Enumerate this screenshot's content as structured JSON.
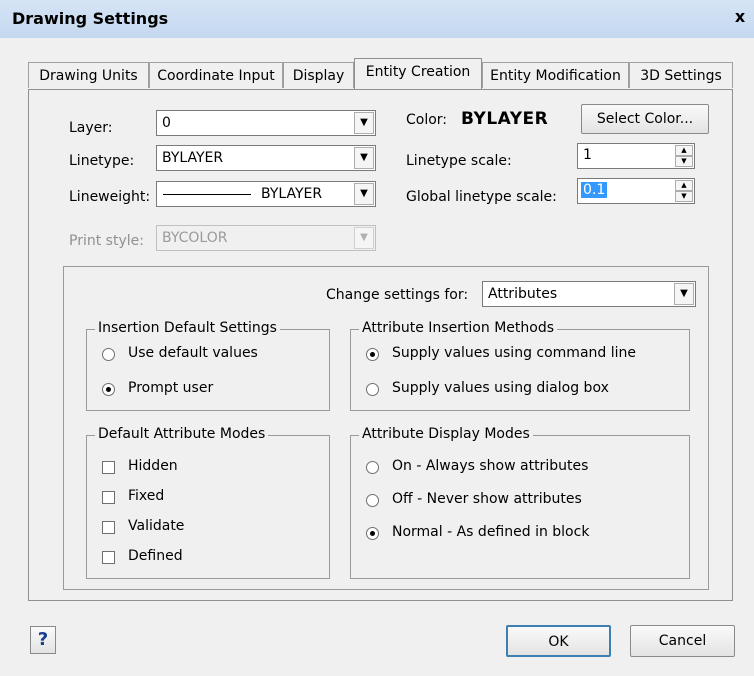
{
  "window": {
    "title": "Drawing Settings",
    "close_glyph": "x"
  },
  "tabs": [
    {
      "label": "Drawing Units"
    },
    {
      "label": "Coordinate Input"
    },
    {
      "label": "Display"
    },
    {
      "label": "Entity Creation"
    },
    {
      "label": "Entity Modification"
    },
    {
      "label": "3D Settings"
    }
  ],
  "active_tab": "Entity Creation",
  "entity": {
    "layer_label": "Layer:",
    "layer_value": "0",
    "linetype_label": "Linetype:",
    "linetype_value": "BYLAYER",
    "lineweight_label": "Lineweight:",
    "lineweight_value": "BYLAYER",
    "print_style_label": "Print style:",
    "print_style_value": "BYCOLOR",
    "color_label": "Color:",
    "color_value": "BYLAYER",
    "select_color_button": "Select Color...",
    "linetype_scale_label": "Linetype scale:",
    "linetype_scale_value": "1",
    "global_linetype_scale_label": "Global linetype scale:",
    "global_linetype_scale_value": "0.1"
  },
  "settings_for": {
    "label": "Change settings for:",
    "value": "Attributes"
  },
  "insertion_defaults": {
    "title": "Insertion Default Settings",
    "options": [
      {
        "label": "Use default values",
        "selected": false
      },
      {
        "label": "Prompt user",
        "selected": true
      }
    ]
  },
  "insertion_methods": {
    "title": "Attribute Insertion Methods",
    "options": [
      {
        "label": "Supply values using command line",
        "selected": true
      },
      {
        "label": "Supply values using dialog box",
        "selected": false
      }
    ]
  },
  "attribute_modes": {
    "title": "Default Attribute Modes",
    "options": [
      {
        "label": "Hidden",
        "checked": false
      },
      {
        "label": "Fixed",
        "checked": false
      },
      {
        "label": "Validate",
        "checked": false
      },
      {
        "label": "Defined",
        "checked": false
      }
    ]
  },
  "display_modes": {
    "title": "Attribute Display Modes",
    "options": [
      {
        "label": "On - Always show attributes",
        "selected": false
      },
      {
        "label": "Off - Never show attributes",
        "selected": false
      },
      {
        "label": "Normal - As defined in block",
        "selected": true
      }
    ]
  },
  "footer": {
    "help_glyph": "?",
    "ok_label": "OK",
    "cancel_label": "Cancel"
  },
  "icons": {
    "dropdown": "chevron-down-icon",
    "spin_up": "spin-up-icon",
    "spin_down": "spin-down-icon"
  }
}
